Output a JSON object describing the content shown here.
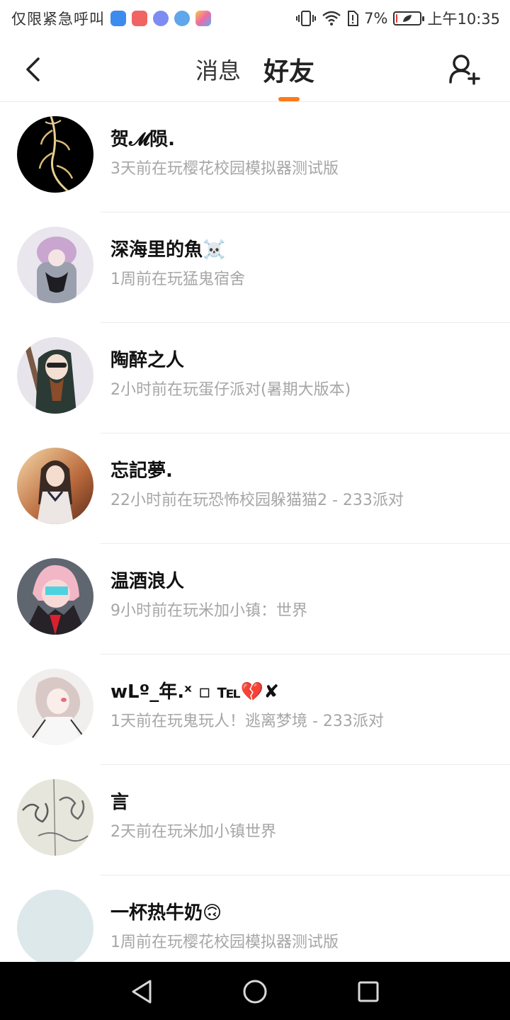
{
  "status_bar": {
    "left_text": "仅限紧急呼叫",
    "battery": "7%",
    "time": "上午10:35",
    "battery_level": 0.07,
    "icons": [
      "shield-app-icon",
      "red-app-icon",
      "music-app-icon",
      "browser-app-icon",
      "gallery-app-icon",
      "vibrate-icon",
      "wifi-icon",
      "sim-icon",
      "battery-icon"
    ]
  },
  "header": {
    "tabs": [
      {
        "label": "消息",
        "active": false
      },
      {
        "label": "好友",
        "active": true
      }
    ],
    "accent_color": "#ff7a1a"
  },
  "friends": [
    {
      "name": "贺𝓜陨.",
      "status": "3天前在玩樱花校园模拟器测试版"
    },
    {
      "name": "深海里的魚☠️",
      "status": "1周前在玩猛鬼宿舍"
    },
    {
      "name": "陶醉之人",
      "status": "2小时前在玩蛋仔派对(暑期大版本)"
    },
    {
      "name": "忘記夢.",
      "status": "22小时前在玩恐怖校园躲猫猫2 - 233派对"
    },
    {
      "name": "温酒浪人",
      "status": "9小时前在玩米加小镇：世界"
    },
    {
      "name": "wLº_年.ˣ ▫ ℡💔✘",
      "status": "1天前在玩鬼玩人！逃离梦境 - 233派对"
    },
    {
      "name": "言",
      "status": "2天前在玩米加小镇世界"
    },
    {
      "name": "一杯热牛奶🙃",
      "status": "1周前在玩樱花校园模拟器测试版"
    }
  ]
}
